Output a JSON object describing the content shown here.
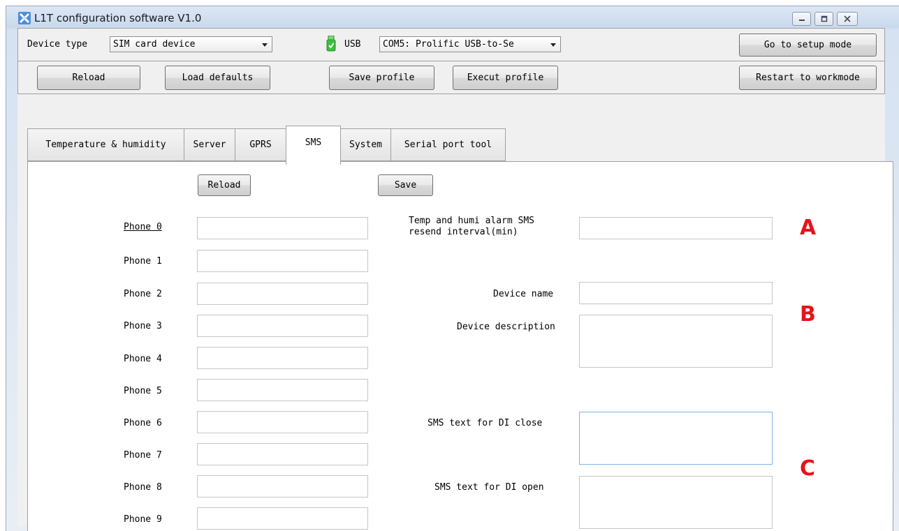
{
  "window": {
    "title": "L1T configuration software V1.0",
    "icons": [
      "app-icon",
      "minimize-icon",
      "maximize-icon",
      "close-icon"
    ]
  },
  "toolbar": {
    "device_type_label": "Device type",
    "device_type_value": "SIM card device",
    "usb_label": "USB",
    "port_value": "COM5: Prolific USB-to-Se",
    "setup_mode_button": "Go to setup mode"
  },
  "actions": {
    "reload": "Reload",
    "load_defaults": "Load defaults",
    "save_profile": "Save profile",
    "execute_profile": "Execut profile",
    "restart": "Restart to workmode"
  },
  "tabs": [
    {
      "label": "Temperature & humidity"
    },
    {
      "label": "Server"
    },
    {
      "label": "GPRS"
    },
    {
      "label": "SMS",
      "active": true
    },
    {
      "label": "System"
    },
    {
      "label": "Serial port tool"
    }
  ],
  "sms": {
    "reload_button": "Reload",
    "save_button": "Save",
    "phones": [
      "Phone 0",
      "Phone 1",
      "Phone 2",
      "Phone 3",
      "Phone 4",
      "Phone 5",
      "Phone 6",
      "Phone 7",
      "Phone 8",
      "Phone 9"
    ],
    "alarm_interval_label_1": "Temp and humi alarm SMS",
    "alarm_interval_label_2": "resend interval(min)",
    "device_name_label": "Device name",
    "device_description_label": "Device description",
    "di_close_label": "SMS text for DI close",
    "di_open_label": "SMS text for DI open"
  },
  "annotations": {
    "a": "A",
    "b": "B",
    "c": "C"
  },
  "colors": {
    "marker": "#e8121a",
    "usb_icon": "#3fbf3f",
    "focus_border": "#7eb4ea"
  }
}
